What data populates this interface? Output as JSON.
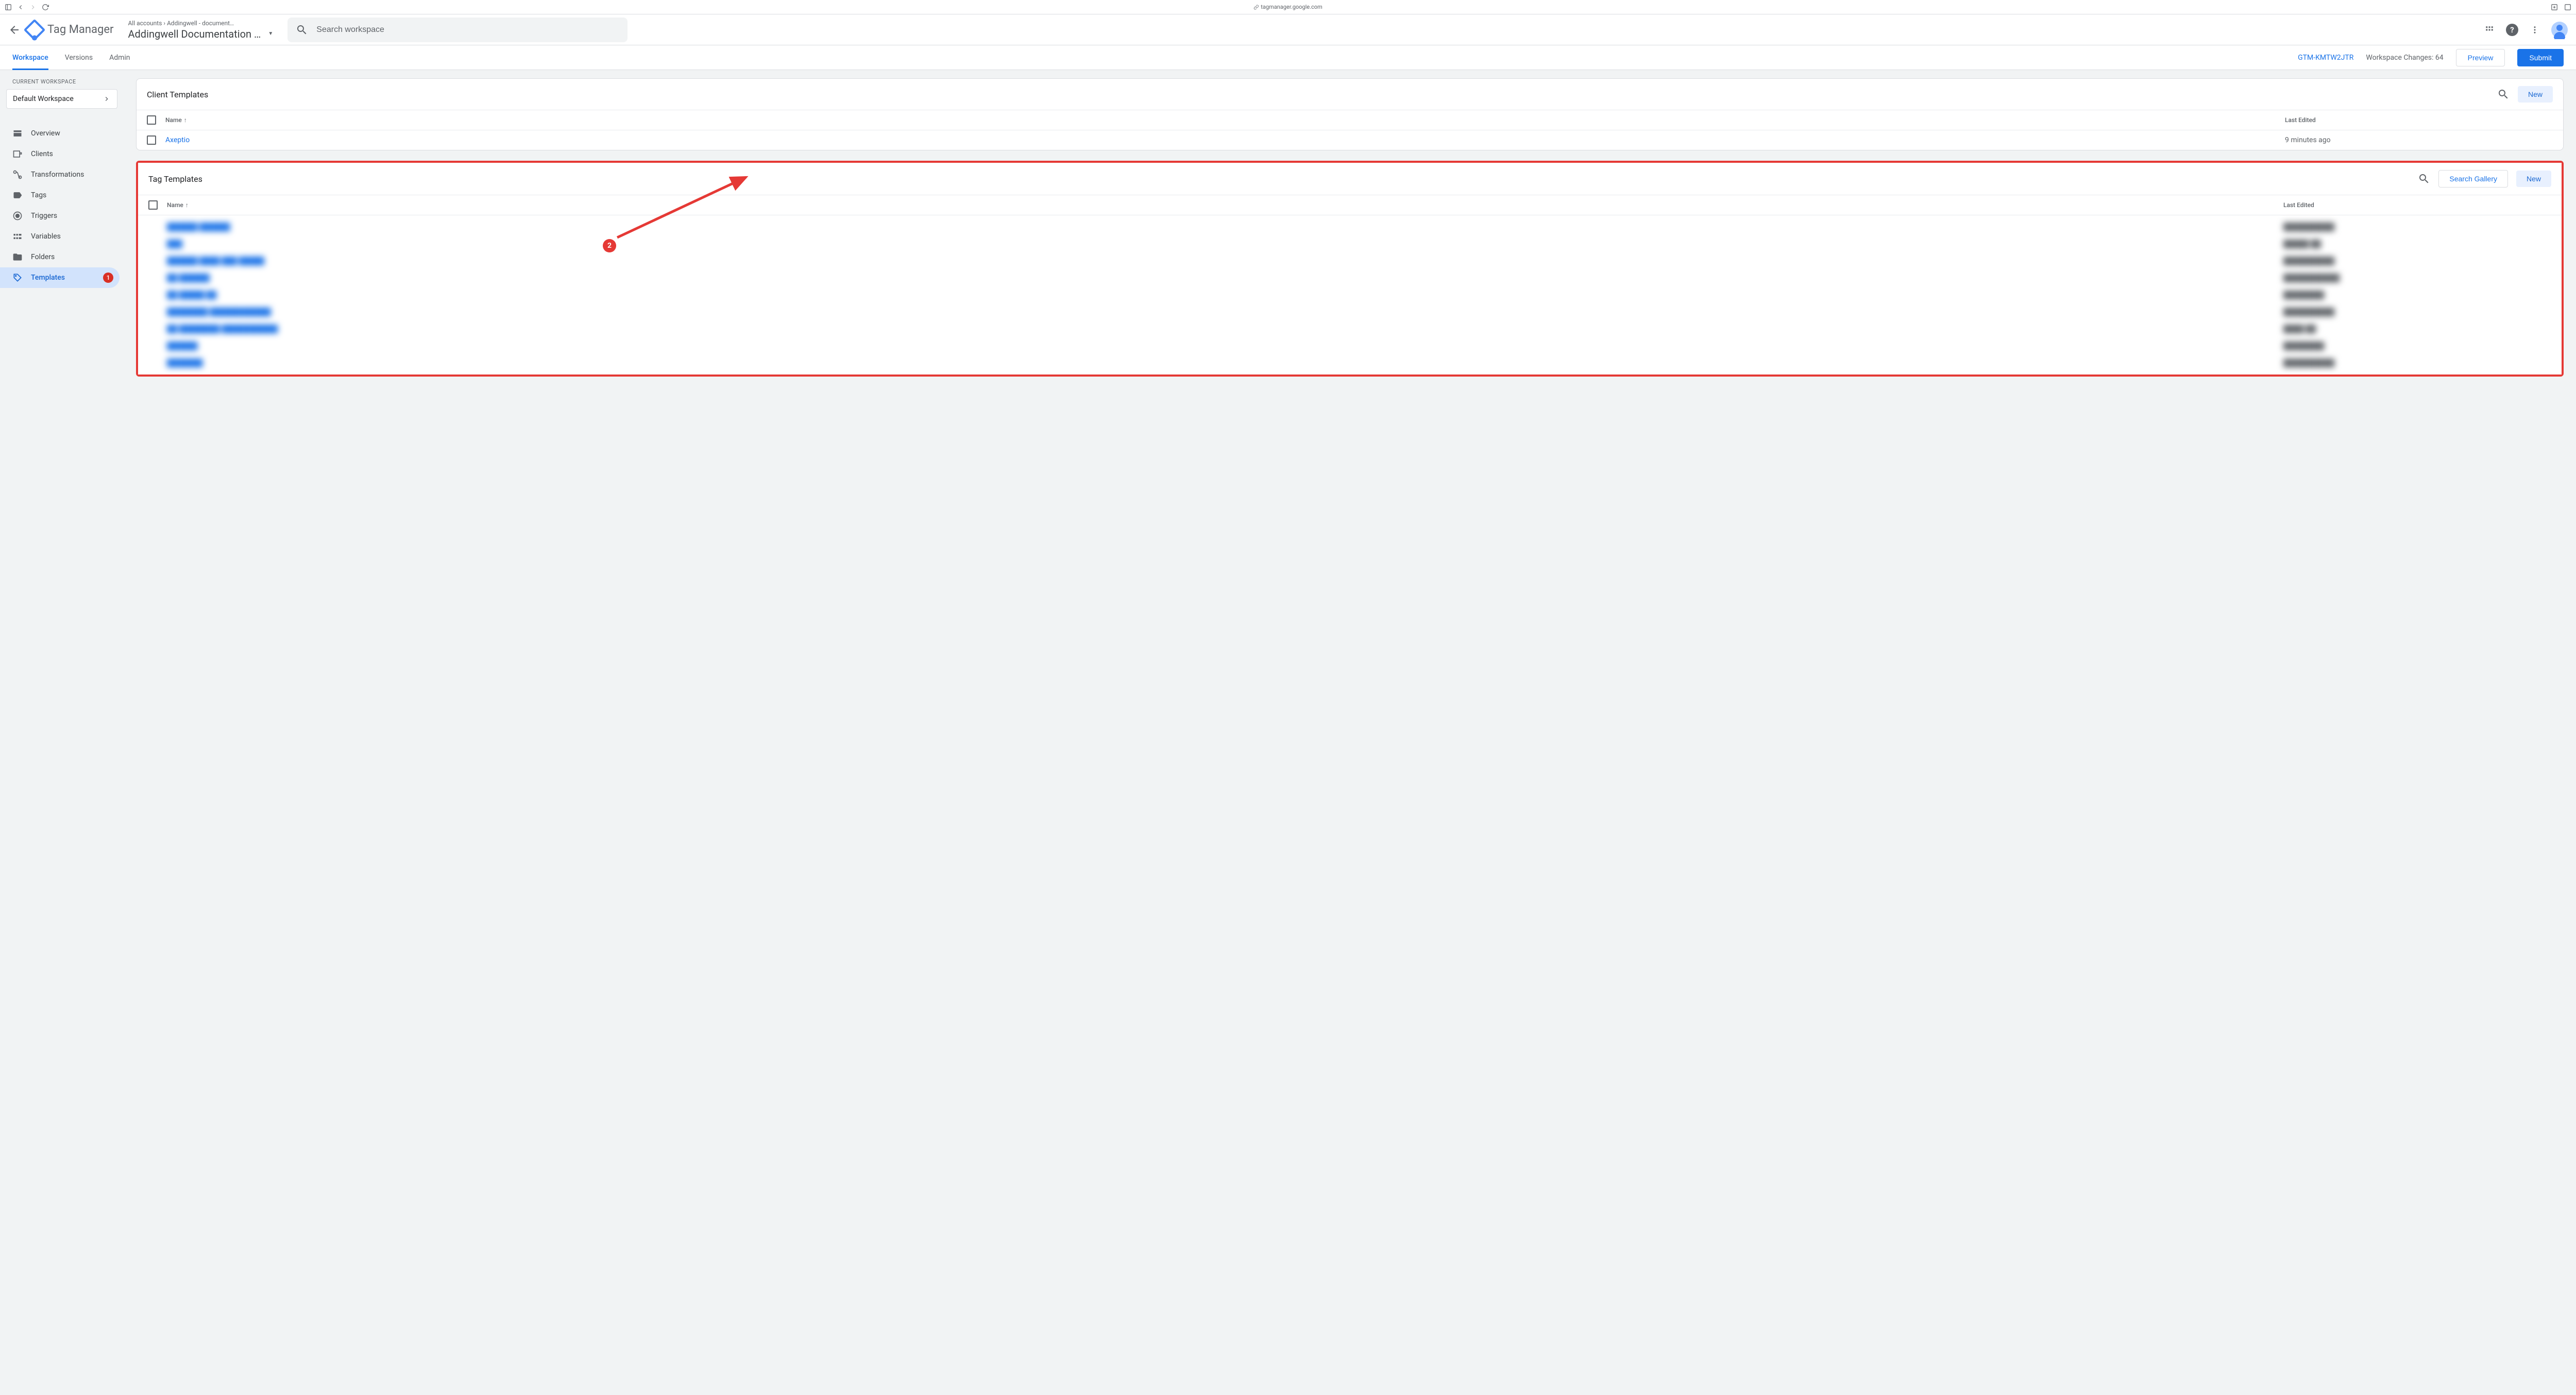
{
  "browser": {
    "url": "tagmanager.google.com"
  },
  "header": {
    "product_name": "Tag Manager",
    "breadcrumb_accounts": "All accounts",
    "breadcrumb_container": "Addingwell - document…",
    "container_name": "Addingwell Documentation …",
    "search_placeholder": "Search workspace"
  },
  "tabbar": {
    "tabs": {
      "workspace": "Workspace",
      "versions": "Versions",
      "admin": "Admin"
    },
    "container_id": "GTM-KMTW2JTR",
    "workspace_changes": "Workspace Changes: 64",
    "preview": "Preview",
    "submit": "Submit"
  },
  "sidebar": {
    "current_label": "CURRENT WORKSPACE",
    "workspace_name": "Default Workspace",
    "nav": {
      "overview": "Overview",
      "clients": "Clients",
      "transformations": "Transformations",
      "tags": "Tags",
      "triggers": "Triggers",
      "variables": "Variables",
      "folders": "Folders",
      "templates": "Templates"
    },
    "templates_badge": "1"
  },
  "panels": {
    "client_templates": {
      "title": "Client Templates",
      "new": "New",
      "col_name": "Name",
      "col_edited": "Last Edited",
      "row_name": "Axeptio",
      "row_edited": "9 minutes ago"
    },
    "tag_templates": {
      "title": "Tag Templates",
      "search_gallery": "Search Gallery",
      "new": "New",
      "col_name": "Name",
      "col_edited": "Last Edited"
    }
  },
  "annotations": {
    "badge2": "2"
  }
}
